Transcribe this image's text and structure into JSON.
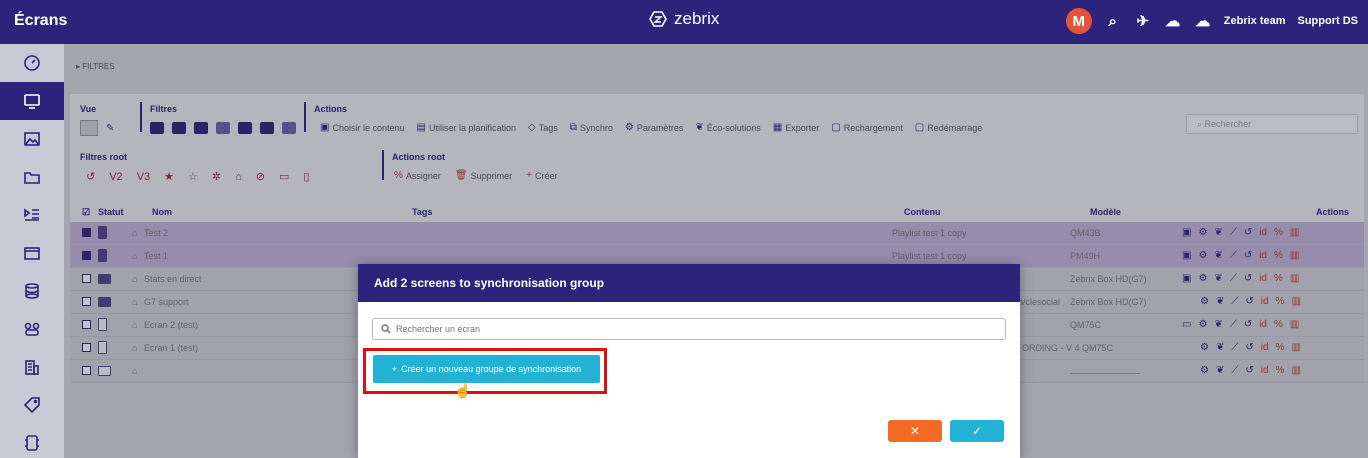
{
  "app": {
    "title": "Écrans",
    "brand": "zebrix",
    "avatar_letter": "M",
    "user_team": "Zebrix team",
    "support": "Support DS"
  },
  "filters_bar": {
    "label": "▸ FILTRES"
  },
  "toolbar": {
    "vue_label": "Vue",
    "filtres_label": "Filtres",
    "actions_label": "Actions",
    "filtres_root_label": "Filtres root",
    "actions_root_label": "Actions root",
    "actions": [
      "Choisir le contenu",
      "Utiliser la planification",
      "Tags",
      "Synchro",
      "Paramètres",
      "Éco-solutions",
      "Exporter",
      "Rechargement",
      "Redémarrage"
    ],
    "root_actions": [
      "Assigner",
      "Supprimer",
      "Créer"
    ],
    "root_filters": [
      "V2",
      "V3"
    ],
    "search_placeholder": "Rechercher"
  },
  "table": {
    "columns": {
      "status": "Statut",
      "name": "Nom",
      "tags": "Tags",
      "content": "Contenu",
      "model": "Modèle",
      "actions": "Actions"
    },
    "rows": [
      {
        "name": "Test 2",
        "content": "Playlist test 1 copy",
        "model": "QM43B",
        "selected": true
      },
      {
        "name": "Test 1",
        "content": "Playlist test 1 copy",
        "model": "PM49H",
        "selected": true
      },
      {
        "name": "Stats en direct",
        "content": "",
        "model": "Zebrix Box HD(G7)",
        "selected": false
      },
      {
        "name": "G7 support",
        "content": "io/clesocial",
        "model": "Zebrix Box HD(G7)",
        "selected": false
      },
      {
        "name": "Ecran 2 (test)",
        "content": "",
        "model": "QM75C",
        "selected": false
      },
      {
        "name": "Ecran 1 (test)",
        "content": "ORDING - V 4",
        "model": "QM75C",
        "selected": false
      },
      {
        "name": "",
        "content": "",
        "model": "",
        "selected": false
      }
    ]
  },
  "modal": {
    "title": "Add 2 screens to synchronisation group",
    "search_placeholder": "Rechercher un écran",
    "create_label": "Créer un nouveau groupe de synchronisation",
    "cancel_symbol": "✕",
    "confirm_symbol": "✓"
  },
  "colors": {
    "primary": "#2d237a",
    "accent": "#21b2d6",
    "cancel": "#f26a24",
    "highlight": "#dd1111"
  }
}
